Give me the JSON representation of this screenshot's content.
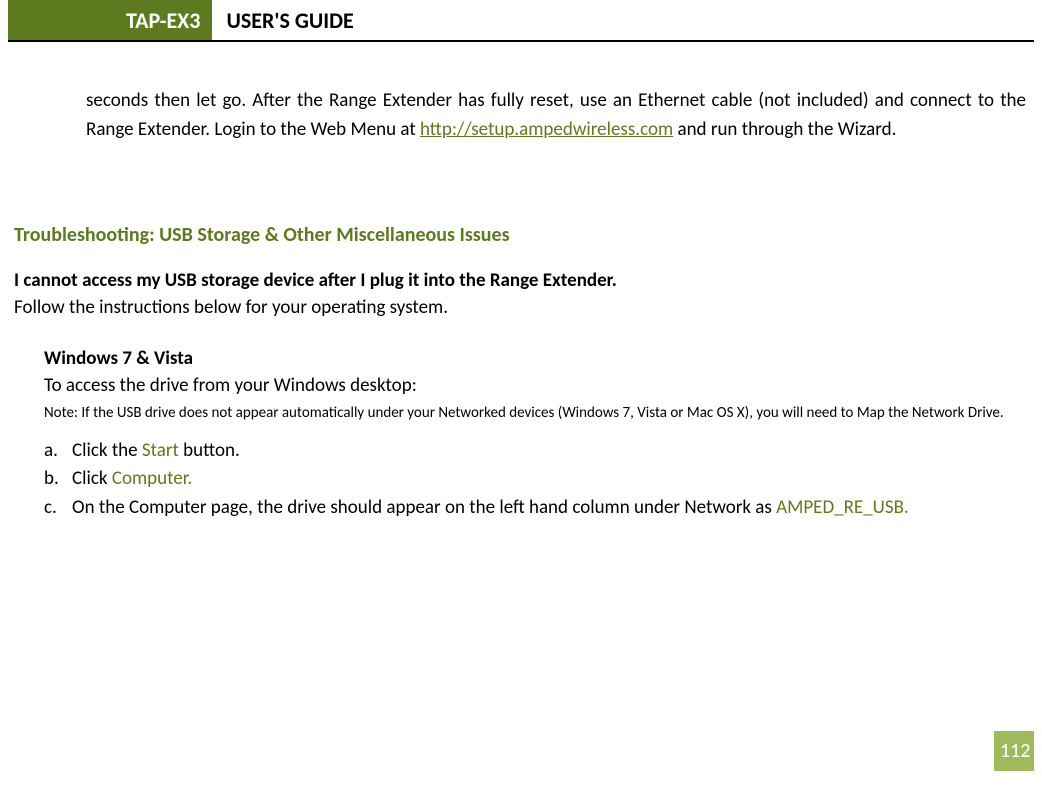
{
  "header": {
    "badge": "TAP-EX3",
    "title": "USER'S GUIDE"
  },
  "topParagraph": {
    "before": "seconds then let go. After the Range Extender has fully reset, use an Ethernet cable (not included) and connect to the Range Extender. Login to the Web Menu at ",
    "link": "http://setup.ampedwireless.com",
    "after": " and run through the Wizard."
  },
  "sectionHeading": "Troubleshooting: USB Storage & Other Miscellaneous Issues",
  "issueTitle": "I cannot access my USB storage device after I plug it into the Range Extender.",
  "introLine": "Follow the instructions below for your operating system.",
  "osBlock": {
    "title": "Windows 7 & Vista",
    "access": "To access the drive from your Windows desktop:",
    "note": "Note: If the USB drive does not appear automatically under your Networked devices (Windows 7, Vista or Mac OS X), you will need to Map the Network Drive.",
    "steps": [
      {
        "marker": "a.",
        "segments": [
          {
            "text": "Click the ",
            "olive": false
          },
          {
            "text": "Start",
            "olive": true
          },
          {
            "text": " button.",
            "olive": false
          }
        ]
      },
      {
        "marker": "b.",
        "segments": [
          {
            "text": "Click ",
            "olive": false
          },
          {
            "text": "Computer.",
            "olive": true
          }
        ]
      },
      {
        "marker": "c.",
        "segments": [
          {
            "text": "On the Computer page, the drive should appear on the left hand column under Network as ",
            "olive": false
          },
          {
            "text": "AMPED_RE_USB.",
            "olive": true
          }
        ]
      }
    ]
  },
  "pageNumber": "112"
}
